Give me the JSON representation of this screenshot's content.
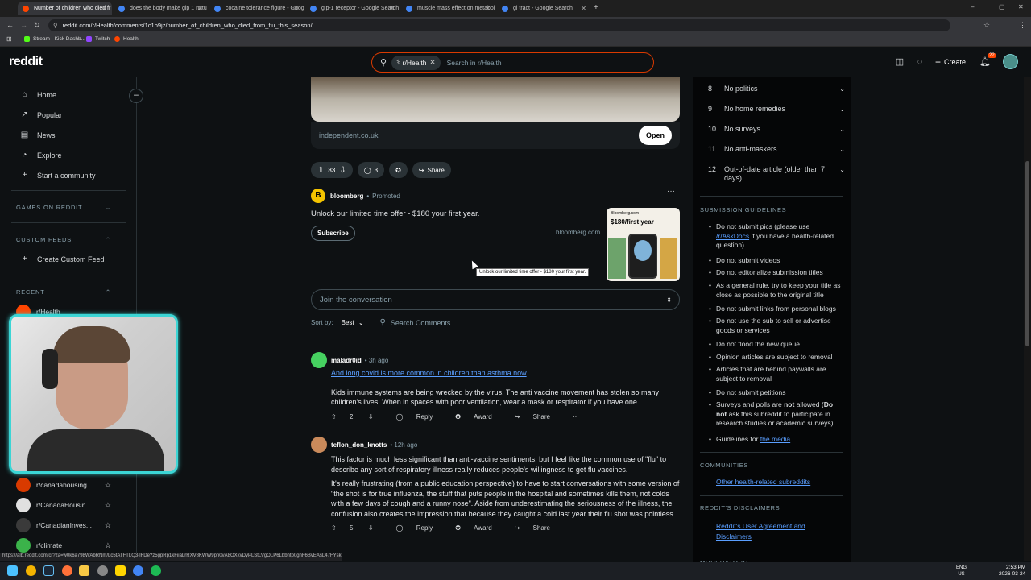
{
  "browser": {
    "tabs": [
      {
        "title": "Number of children who died fr",
        "color": "#ff4500",
        "active": true
      },
      {
        "title": "does the body make glp 1 natu",
        "color": "#4285f4",
        "active": false
      },
      {
        "title": "cocaine tolerance figure - Goog",
        "color": "#4285f4",
        "active": false
      },
      {
        "title": "glp-1 receptor - Google Search",
        "color": "#4285f4",
        "active": false
      },
      {
        "title": "muscle mass effect on metabol",
        "color": "#4285f4",
        "active": false
      },
      {
        "title": "gi tract - Google Search",
        "color": "#4285f4",
        "active": false
      }
    ],
    "new_tab": "+",
    "url": "reddit.com/r/Health/comments/1c1o9jz/number_of_children_who_died_from_flu_this_season/",
    "bookmarks": [
      {
        "label": "Stream - Kick Dashb...",
        "color": "#53fc18"
      },
      {
        "label": "Twitch",
        "color": "#9146ff"
      },
      {
        "label": "Health",
        "color": "#ff4500"
      }
    ],
    "window_controls": {
      "minimize": "–",
      "maximize": "▢",
      "close": "✕"
    }
  },
  "header": {
    "logo": "reddit",
    "search_chip": "r/Health",
    "search_placeholder": "Search in r/Health",
    "create_label": "Create",
    "notif_count": "22"
  },
  "sidebar": {
    "nav": [
      {
        "label": "Home",
        "icon": "home-icon",
        "glyph": "⌂"
      },
      {
        "label": "Popular",
        "icon": "popular-icon",
        "glyph": "↗"
      },
      {
        "label": "News",
        "icon": "news-icon",
        "glyph": "▤"
      },
      {
        "label": "Explore",
        "icon": "explore-icon",
        "glyph": "◔"
      },
      {
        "label": "Start a community",
        "icon": "plus-icon",
        "glyph": "+"
      }
    ],
    "games_title": "GAMES ON REDDIT",
    "custom_feeds_title": "CUSTOM FEEDS",
    "create_custom_feed": "Create Custom Feed",
    "recent_title": "RECENT",
    "recent": [
      {
        "name": "r/Health",
        "color": "#ff4500"
      },
      {
        "name": "r/canadahousing",
        "color": "#d93a00"
      },
      {
        "name": "r/CanadaHousin...",
        "color": "#e0e0e0"
      },
      {
        "name": "r/CanadianInves...",
        "color": "#3a3a3a"
      },
      {
        "name": "r/climate",
        "color": "#3bb34a"
      }
    ]
  },
  "post": {
    "domain": "independent.co.uk",
    "open_label": "Open",
    "votes": "83",
    "comments": "3",
    "share_label": "Share"
  },
  "promo": {
    "advertiser": "bloomberg",
    "tag": "Promoted",
    "title": "Unlock our limited time offer - $180 your first year.",
    "cta": "Subscribe",
    "domain": "bloomberg.com",
    "card_brand": "Bloomberg.com",
    "card_price": "$180/first year",
    "tooltip": "Unlock our limited time offer - $180 your first year."
  },
  "conversation": {
    "join_placeholder": "Join the conversation",
    "sort_label": "Sort by:",
    "sort_value": "Best",
    "search_comments": "Search Comments"
  },
  "comments": [
    {
      "user": "maladr0id",
      "time": "3h ago",
      "avatar_color": "#46d160",
      "link": "And long covid is more common in children than asthma now",
      "paragraphs": [
        "Kids immune systems are being wrecked by the virus. The anti vaccine movement has stolen so many children's lives. When in spaces with poor ventilation, wear a mask or respirator if you have one."
      ],
      "votes": "2"
    },
    {
      "user": "teflon_don_knotts",
      "time": "12h ago",
      "avatar_color": "#c98a5b",
      "link": "",
      "paragraphs": [
        "This factor is much less significant than anti-vaccine sentiments, but I feel like the common use of \"flu\" to describe any sort of respiratory illness really reduces people's willingness to get flu vaccines.",
        "It's really frustrating (from a public education perspective) to have to start conversations with some version of \"the shot is for true influenza, the stuff that puts people in the hospital and sometimes kills them, not colds with a few days of cough and a runny nose\". Aside from underestimating the seriousness of the illness, the confusion also creates the impression that because they caught a cold last year their flu shot was pointless."
      ],
      "votes": "5"
    }
  ],
  "comment_actions": {
    "reply": "Reply",
    "award": "Award",
    "share": "Share",
    "more": "···"
  },
  "rules": [
    {
      "num": "8",
      "text": "No politics"
    },
    {
      "num": "9",
      "text": "No home remedies"
    },
    {
      "num": "10",
      "text": "No surveys"
    },
    {
      "num": "11",
      "text": "No anti-maskers"
    },
    {
      "num": "12",
      "text": "Out-of-date article (older than 7 days)"
    }
  ],
  "guidelines_title": "SUBMISSION GUIDELINES",
  "guidelines": {
    "g1a": "Do not submit pics (please use ",
    "g1link": "/r/AskDocs",
    "g1b": " if you have a health-related question)",
    "g2": "Do not submit videos",
    "g3": "Do not editorialize submission titles",
    "g4": "As a general rule, try to keep your title as close as possible to the original title",
    "g5": "Do not submit links from personal blogs",
    "g6": "Do not use the sub to sell or advertise goods or services",
    "g7": "Do not flood the new queue",
    "g8": "Opinion articles are subject to removal",
    "g9": "Articles that are behind paywalls are subject to removal",
    "g10": "Do not submit petitions",
    "g11a": "Surveys and polls are ",
    "g11b": "not",
    "g11c": " allowed (",
    "g11d": "Do not",
    "g11e": " ask this subreddit to participate in research studies or academic surveys)",
    "g12a": "Guidelines for ",
    "g12link": "the media"
  },
  "communities_title": "COMMUNITIES",
  "communities_link": "Other health-related subreddits",
  "disclaimers_title": "REDDIT'S DISCLAIMERS",
  "disclaimers_link": "Reddit's User Agreement and Disclaimers",
  "moderators_title": "MODERATORS",
  "statusbar": "https://alb.reddit.com/cr?za=w0k6a798WAbRNm/Lc5tATFTLQ3-lFDe?z5gpRp1kFiiaLrRXV8KWW9pn0vA8OXkvDyPLStLVgOLP6Lbbhtp0gnF6BvEAsL47FYsk...",
  "taskbar": {
    "lang": "ENG",
    "region": "US",
    "time": "2:53 PM",
    "date": "2026-03-24"
  }
}
